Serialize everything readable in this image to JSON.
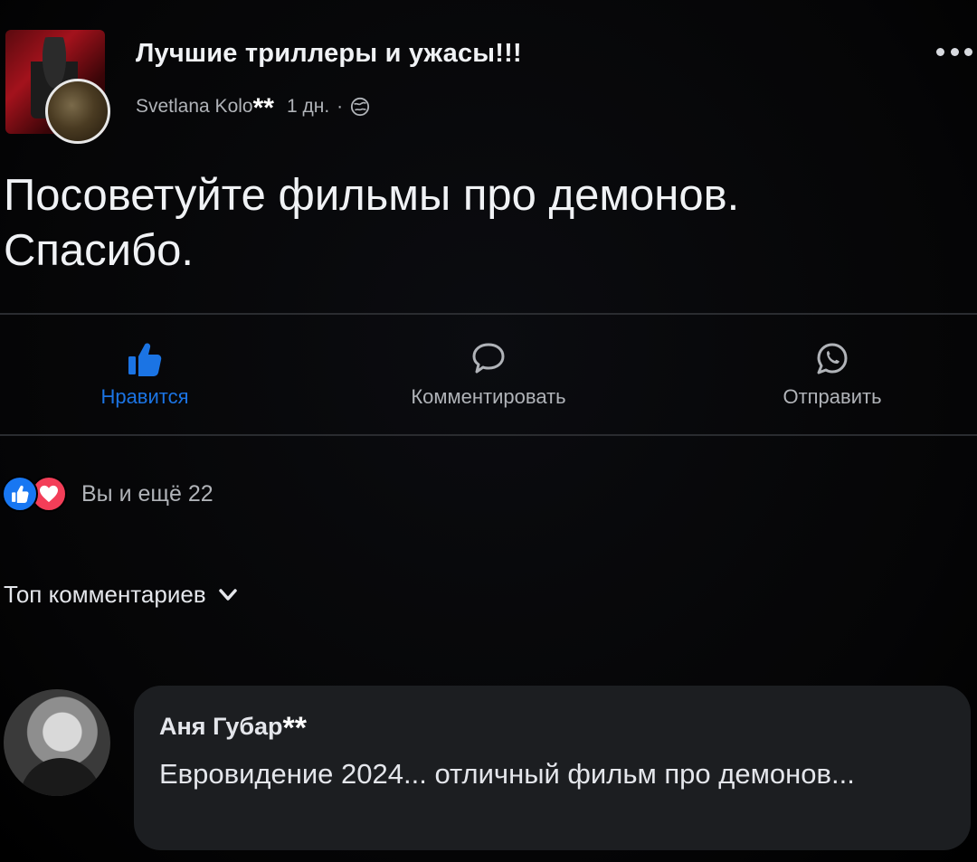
{
  "header": {
    "group_name": "Лучшие триллеры и ужасы!!!",
    "author_name": "Svetlana Kolo",
    "author_mask": "**",
    "time": "1 дн.",
    "separator": "·"
  },
  "post": {
    "line1": "Посоветуйте фильмы про демонов.",
    "line2": "Спасибо."
  },
  "actions": {
    "like": "Нравится",
    "comment": "Комментировать",
    "send": "Отправить"
  },
  "reactions": {
    "summary": "Вы и ещё 22"
  },
  "sort": {
    "label": "Топ комментариев"
  },
  "comment": {
    "author_name": "Аня Губар",
    "author_mask": "**",
    "text": "Евровидение 2024... отличный фильм про демонов..."
  },
  "colors": {
    "accent": "#1b74e4",
    "like_reaction": "#1877f2",
    "love_reaction": "#f33e58",
    "background": "#000000",
    "comment_bubble": "#1c1e21"
  },
  "icons": {
    "like": "thumbs-up-icon",
    "comment": "speech-bubble-icon",
    "send": "whatsapp-icon",
    "audience": "globe-icon",
    "more": "more-dots-icon",
    "sort": "chevron-down-icon"
  }
}
